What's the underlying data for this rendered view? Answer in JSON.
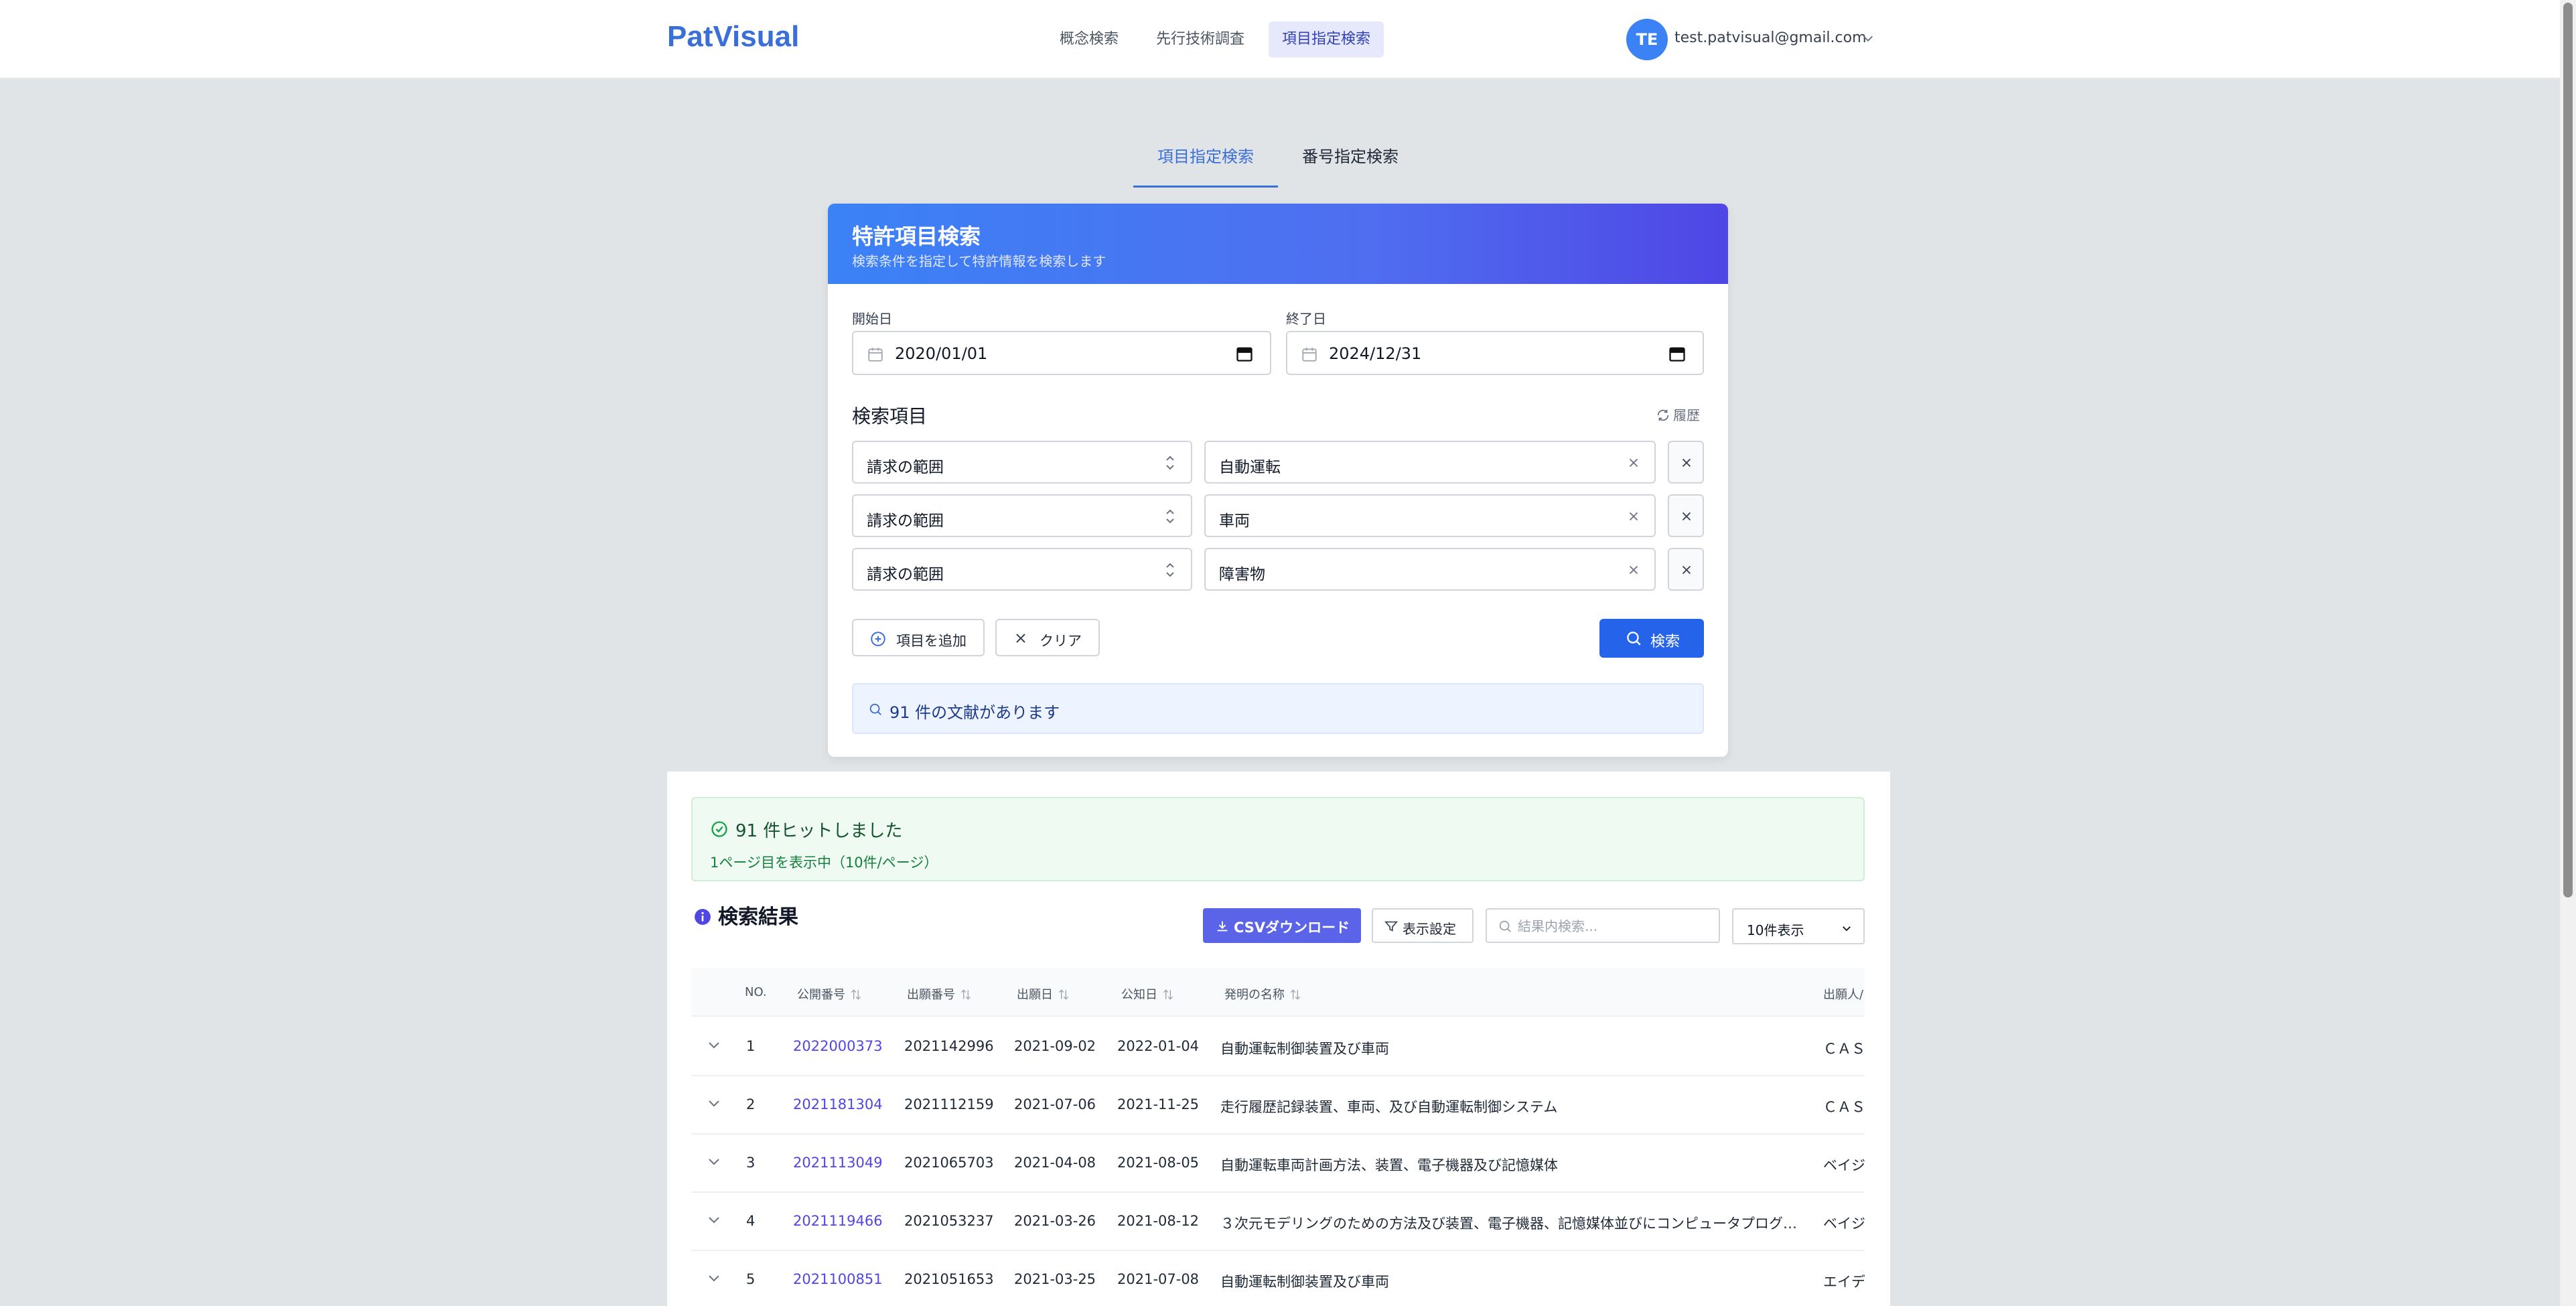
{
  "app": {
    "logo": "PatVisual"
  },
  "nav": {
    "items": [
      {
        "label": "概念検索"
      },
      {
        "label": "先行技術調査"
      },
      {
        "label": "項目指定検索"
      }
    ]
  },
  "user": {
    "initials": "TE",
    "email": "test.patvisual@gmail.com"
  },
  "mode_tabs": [
    {
      "label": "項目指定検索"
    },
    {
      "label": "番号指定検索"
    }
  ],
  "search_card": {
    "title": "特許項目検索",
    "subtitle": "検索条件を指定して特許情報を検索します",
    "start_label": "開始日",
    "start_value": "2020/01/01",
    "end_label": "終了日",
    "end_value": "2024/12/31",
    "section_title": "検索項目",
    "history_label": "履歴",
    "rows": [
      {
        "field": "請求の範囲",
        "term": "自動運転"
      },
      {
        "field": "請求の範囲",
        "term": "車両"
      },
      {
        "field": "請求の範囲",
        "term": "障害物"
      }
    ],
    "add_label": "項目を追加",
    "clear_label": "クリア",
    "search_label": "検索",
    "info_text": "91 件の文献があります"
  },
  "results": {
    "hit_title": "91 件ヒットしました",
    "hit_sub": "1ページ目を表示中（10件/ページ）",
    "title": "検索結果",
    "csv_label": "CSVダウンロード",
    "display_label": "表示設定",
    "search_placeholder": "結果内検索...",
    "page_size": "10件表示",
    "columns": {
      "no": "NO.",
      "pub_no": "公開番号",
      "app_no": "出願番号",
      "app_date": "出願日",
      "pub_date": "公知日",
      "title": "発明の名称",
      "applicant": "出願人/"
    },
    "rows": [
      {
        "no": "1",
        "pub_no": "2022000373",
        "app_no": "2021142996",
        "app_date": "2021-09-02",
        "pub_date": "2022-01-04",
        "title": "自動運転制御装置及び車両",
        "applicant": "ＣＡＳ"
      },
      {
        "no": "2",
        "pub_no": "2021181304",
        "app_no": "2021112159",
        "app_date": "2021-07-06",
        "pub_date": "2021-11-25",
        "title": "走行履歴記録装置、車両、及び自動運転制御システム",
        "applicant": "ＣＡＳ"
      },
      {
        "no": "3",
        "pub_no": "2021113049",
        "app_no": "2021065703",
        "app_date": "2021-04-08",
        "pub_date": "2021-08-05",
        "title": "自動運転車両計画方法、装置、電子機器及び記憶媒体",
        "applicant": "ベイジ"
      },
      {
        "no": "4",
        "pub_no": "2021119466",
        "app_no": "2021053237",
        "app_date": "2021-03-26",
        "pub_date": "2021-08-12",
        "title": "３次元モデリングのための方法及び装置、電子機器、記憶媒体並びにコンピュータプログ…",
        "applicant": "ベイジ"
      },
      {
        "no": "5",
        "pub_no": "2021100851",
        "app_no": "2021051653",
        "app_date": "2021-03-25",
        "pub_date": "2021-07-08",
        "title": "自動運転制御装置及び車両",
        "applicant": "エイデ"
      }
    ]
  }
}
